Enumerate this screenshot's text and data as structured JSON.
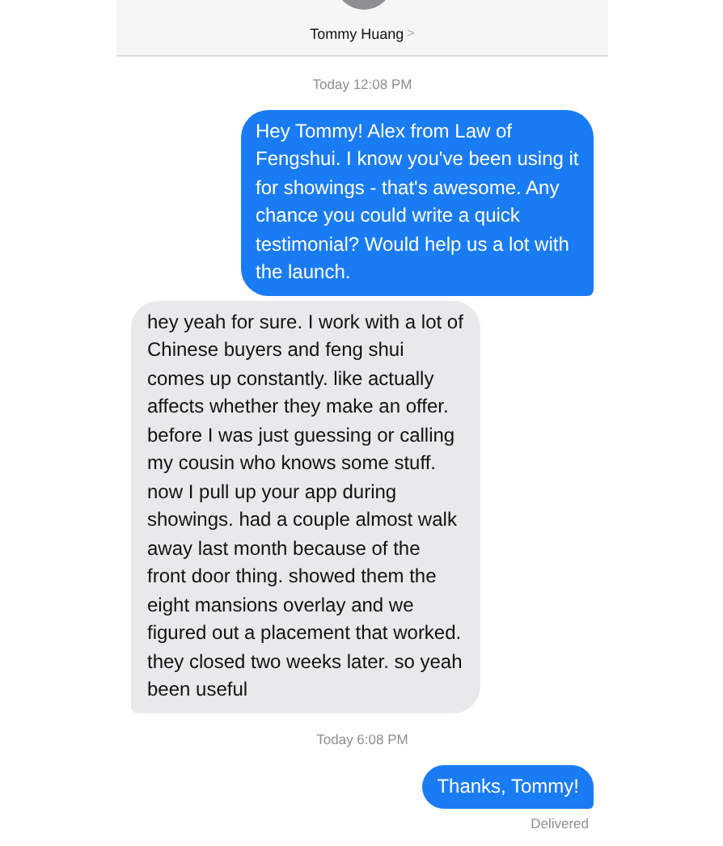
{
  "header": {
    "contact_name": "Tommy Huang",
    "chevron": ">"
  },
  "thread": [
    {
      "kind": "timestamp",
      "text": "Today 12:08 PM"
    },
    {
      "kind": "sent",
      "text": "Hey Tommy! Alex from Law of Fengshui. I know you've been using it for showings - that's awesome. Any chance you could write a quick testimonial? Would help us a lot with the launch."
    },
    {
      "kind": "received",
      "text": "hey yeah for sure. I work with a lot of Chinese buyers and feng shui comes up constantly. like actually affects whether they make an offer. before I was just guessing or calling my cousin who knows some stuff. now I pull up your app during showings. had a couple almost walk away last month because of the front door thing. showed them the eight mansions overlay and we figured out a placement that worked. they closed two weeks later. so yeah been useful"
    },
    {
      "kind": "timestamp",
      "text": "Today 6:08 PM"
    },
    {
      "kind": "sent",
      "text": "Thanks, Tommy!"
    },
    {
      "kind": "status",
      "text": "Delivered"
    }
  ]
}
